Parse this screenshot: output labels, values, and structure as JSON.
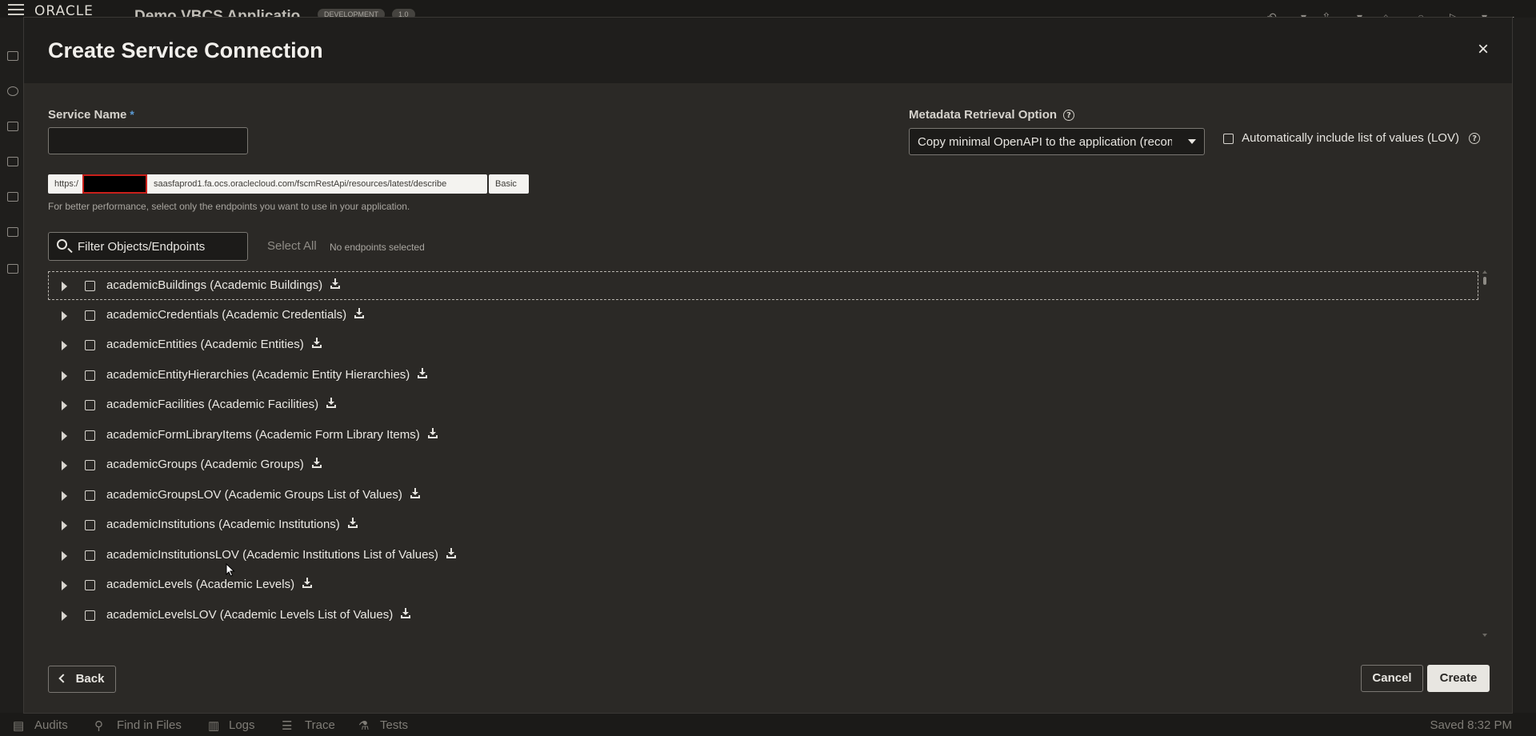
{
  "app": {
    "brand": "ORACLE",
    "name": "Demo VBCS Applicatio",
    "badges": [
      "DEVELOPMENT",
      "1.0"
    ]
  },
  "bottom_bar": {
    "items": [
      "Audits",
      "Find in Files",
      "Logs",
      "Trace",
      "Tests"
    ],
    "status": "Saved 8:32 PM"
  },
  "dialog": {
    "title": "Create Service Connection",
    "close_icon": "×",
    "service_name": {
      "label": "Service Name",
      "required_mark": "*",
      "value": ""
    },
    "metadata": {
      "label": "Metadata Retrieval Option",
      "selected": "Copy minimal OpenAPI to the application (recommended)"
    },
    "lov": {
      "label": "Automatically include list of values (LOV)",
      "checked": false
    },
    "url": {
      "scheme": "https:/",
      "path": "saasfaprod1.fa.ocs.oraclecloud.com/fscmRestApi/resources/latest/describe",
      "auth": "Basic"
    },
    "hint": "For better performance, select only the endpoints you want to use in your application.",
    "filter_placeholder": "Filter Objects/Endpoints",
    "select_all": "Select All",
    "selection_status": "No endpoints selected",
    "endpoints": [
      "academicBuildings (Academic Buildings)",
      "academicCredentials (Academic Credentials)",
      "academicEntities (Academic Entities)",
      "academicEntityHierarchies (Academic Entity Hierarchies)",
      "academicFacilities (Academic Facilities)",
      "academicFormLibraryItems (Academic Form Library Items)",
      "academicGroups (Academic Groups)",
      "academicGroupsLOV (Academic Groups List of Values)",
      "academicInstitutions (Academic Institutions)",
      "academicInstitutionsLOV (Academic Institutions List of Values)",
      "academicLevels (Academic Levels)",
      "academicLevelsLOV (Academic Levels List of Values)"
    ],
    "buttons": {
      "back": "Back",
      "cancel": "Cancel",
      "create": "Create"
    }
  },
  "colors": {
    "dialog_bg": "#2b2926",
    "header_bg": "#1f1e1c",
    "required": "#5b9bd5",
    "redaction_border": "#c9201b"
  }
}
